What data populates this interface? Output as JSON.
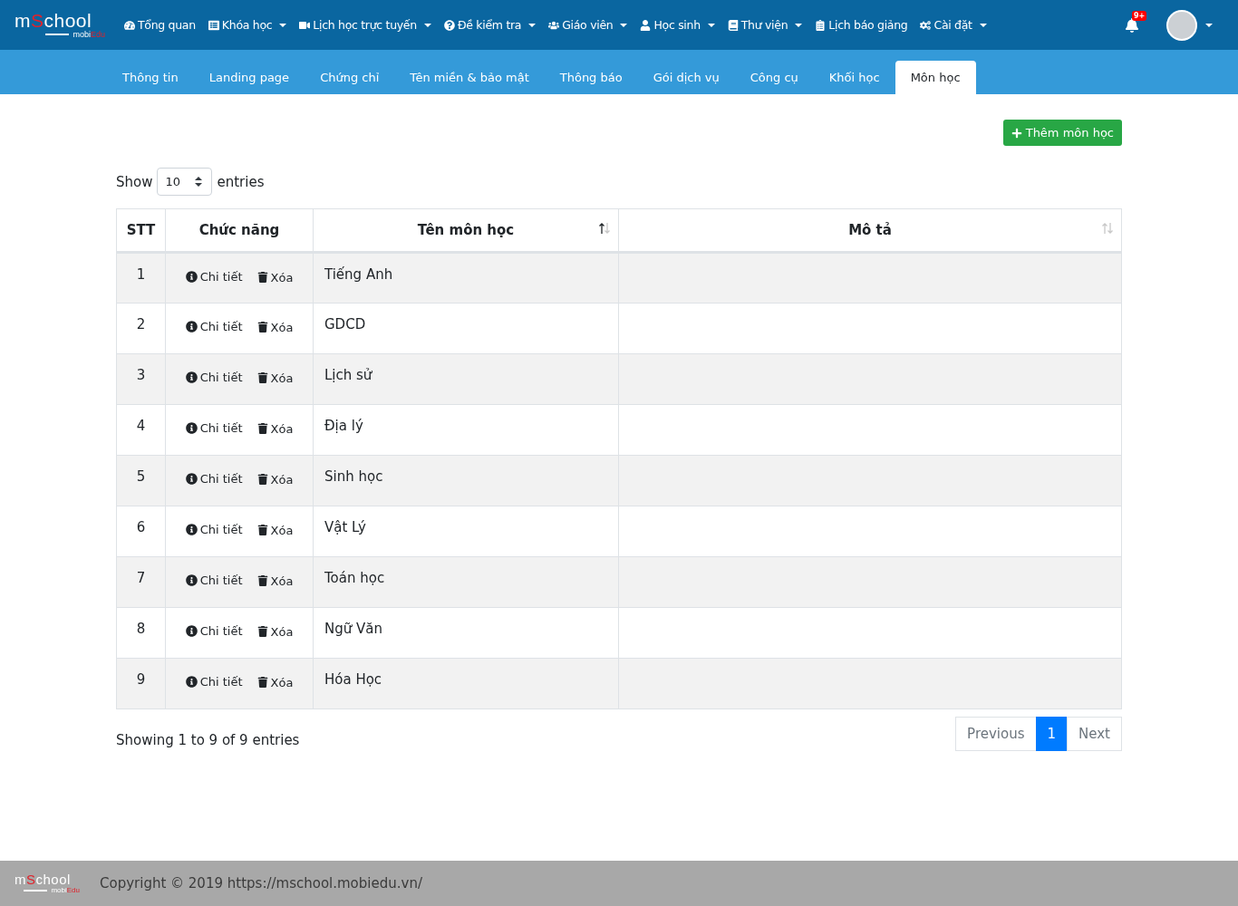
{
  "logo": {
    "pre": "m",
    "accent": "S",
    "post": "chool",
    "sub_pre": "mobi",
    "sub_accent": "Edu"
  },
  "nav": [
    {
      "label": "Tổng quan",
      "dropdown": false
    },
    {
      "label": "Khóa học",
      "dropdown": true
    },
    {
      "label": "Lịch học trực tuyến",
      "dropdown": true
    },
    {
      "label": "Đề kiểm tra",
      "dropdown": true
    },
    {
      "label": "Giáo viên",
      "dropdown": true
    },
    {
      "label": "Học sinh",
      "dropdown": true
    },
    {
      "label": "Thư viện",
      "dropdown": true
    },
    {
      "label": "Lịch báo giảng",
      "dropdown": false
    },
    {
      "label": "Cài đặt",
      "dropdown": true
    }
  ],
  "notifications": {
    "badge": "9+"
  },
  "tabs": [
    {
      "label": "Thông tin",
      "selected": false
    },
    {
      "label": "Landing page",
      "selected": false
    },
    {
      "label": "Chứng chỉ",
      "selected": false
    },
    {
      "label": "Tên miền & bảo mật",
      "selected": false
    },
    {
      "label": "Thông báo",
      "selected": false
    },
    {
      "label": "Gói dịch vụ",
      "selected": false
    },
    {
      "label": "Công cụ",
      "selected": false
    },
    {
      "label": "Khối học",
      "selected": false
    },
    {
      "label": "Môn học",
      "selected": true
    }
  ],
  "add_button": "Thêm môn học",
  "length": {
    "before": "Show",
    "value": "10",
    "after": "entries"
  },
  "table": {
    "columns": [
      {
        "label": "STT"
      },
      {
        "label": "Chức năng"
      },
      {
        "label": "Tên môn học",
        "sortable": true,
        "sorted_ascending": true
      },
      {
        "label": "Mô tả",
        "sortable": true,
        "sorted_ascending": false
      }
    ],
    "rows": [
      {
        "stt": "1",
        "detail": "Chi tiết",
        "delete": "Xóa",
        "name": "Tiếng Anh"
      },
      {
        "stt": "2",
        "detail": "Chi tiết",
        "delete": "Xóa",
        "name": "GDCD"
      },
      {
        "stt": "3",
        "detail": "Chi tiết",
        "delete": "Xóa",
        "name": "Lịch sử"
      },
      {
        "stt": "4",
        "detail": "Chi tiết",
        "delete": "Xóa",
        "name": "Địa lý"
      },
      {
        "stt": "5",
        "detail": "Chi tiết",
        "delete": "Xóa",
        "name": "Sinh học"
      },
      {
        "stt": "6",
        "detail": "Chi tiết",
        "delete": "Xóa",
        "name": "Vật Lý"
      },
      {
        "stt": "7",
        "detail": "Chi tiết",
        "delete": "Xóa",
        "name": "Toán học"
      },
      {
        "stt": "8",
        "detail": "Chi tiết",
        "delete": "Xóa",
        "name": "Ngữ Văn"
      },
      {
        "stt": "9",
        "detail": "Chi tiết",
        "delete": "Xóa",
        "name": "Hóa Học"
      }
    ]
  },
  "info": "Showing 1 to 9 of 9 entries",
  "pagination": {
    "previous": {
      "label": "Previous",
      "disabled": true
    },
    "pages": [
      {
        "label": "1",
        "selected": true
      }
    ],
    "next": {
      "label": "Next",
      "disabled": true
    }
  },
  "footer": {
    "logo": {
      "pre": "m",
      "accent": "S",
      "post": "chool",
      "sub_pre": "mobi",
      "sub_accent": "Edu"
    },
    "copyright": "Copyright © 2019 https://mschool.mobiedu.vn/"
  }
}
